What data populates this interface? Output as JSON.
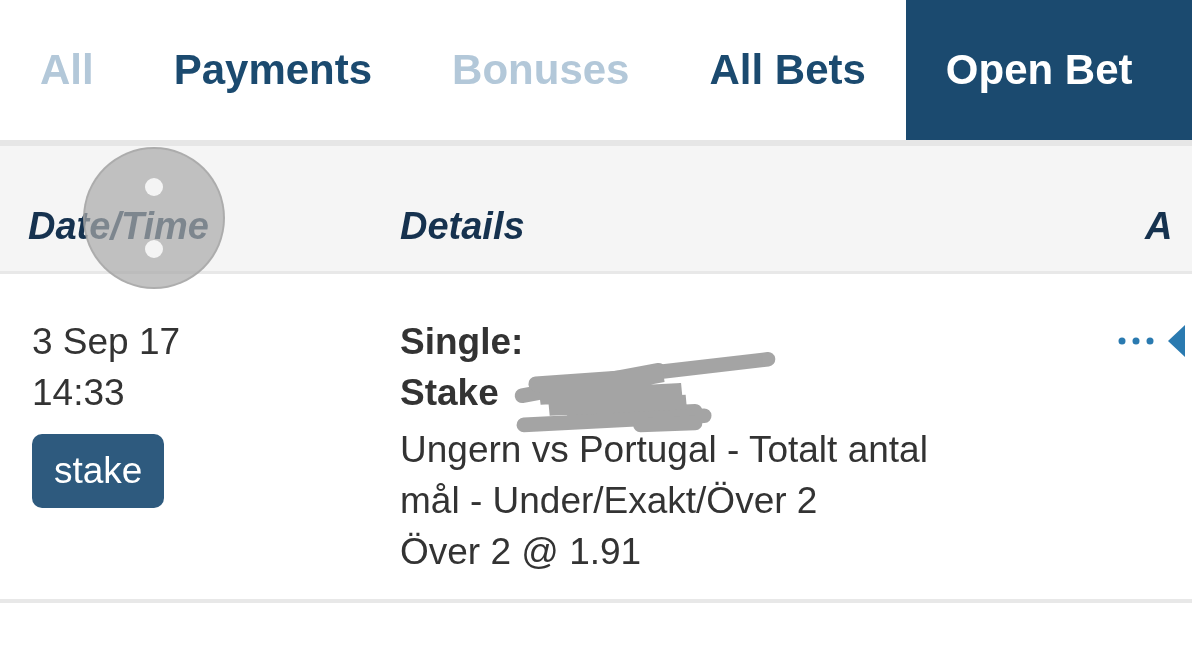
{
  "tabs": [
    {
      "label": "All",
      "selected": false,
      "disabled": true
    },
    {
      "label": "Payments",
      "selected": false,
      "disabled": false
    },
    {
      "label": "Bonuses",
      "selected": false,
      "disabled": true
    },
    {
      "label": "All Bets",
      "selected": false,
      "disabled": false
    },
    {
      "label": "Open Bet",
      "selected": true,
      "disabled": false
    }
  ],
  "table": {
    "columns": [
      "Date/Time",
      "Details",
      "A"
    ],
    "rows": [
      {
        "date": "3 Sep 17",
        "time": "14:33",
        "tag": "stake",
        "bet_type": "Single:",
        "stake_label": "Stake",
        "description": "Ungern vs Portugal - Totalt antal mål - Under/Exakt/Över 2",
        "selection": "Över 2 @ 1.91"
      }
    ]
  }
}
